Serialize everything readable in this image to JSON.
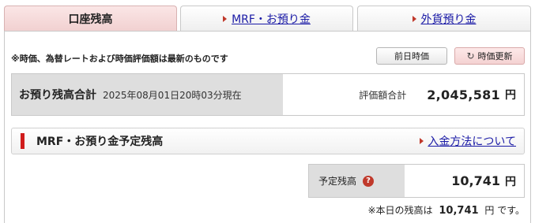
{
  "tabs": [
    {
      "label": "口座残高",
      "active": true
    },
    {
      "label": "MRF・お預り金",
      "active": false
    },
    {
      "label": "外貨預り金",
      "active": false
    }
  ],
  "notice": "※時価、為替レートおよび時価評価額は最新のものです",
  "buttons": {
    "prev_day": "前日時価",
    "refresh": "時価更新"
  },
  "total": {
    "title": "お預り残高合計",
    "as_of": "2025年08月01日20時03分現在",
    "label": "評価額合計",
    "value": "2,045,581",
    "unit": "円"
  },
  "mrf_section": {
    "title": "MRF・お預り金予定残高",
    "link": "入金方法について"
  },
  "scheduled": {
    "label": "予定残高",
    "value": "10,741",
    "unit": "円"
  },
  "footnote": {
    "prefix": "※本日の残高は",
    "value": "10,741",
    "suffix": "円 です。"
  },
  "colors": {
    "accent_red": "#d01c1c",
    "link_blue": "#1a1aa6",
    "active_tab_bg": "#f1d0d0",
    "label_bg": "#dedede"
  }
}
